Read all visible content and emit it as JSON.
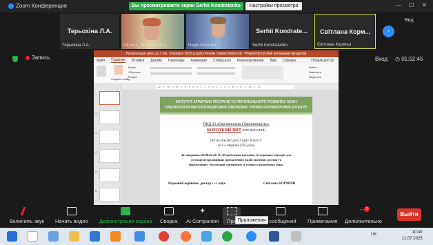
{
  "window": {
    "title": "Zoom Конференция",
    "share_banner": "Вы просматриваете экран Serhii Kondratenko",
    "view_settings": "Настройки просмотра",
    "view_label": "Вид",
    "controls": [
      "—",
      "☐",
      "✕"
    ]
  },
  "participants": [
    {
      "display": "Терьохіна Л.А.",
      "caption": "Терьохіна Л.А.",
      "video": false
    },
    {
      "display": "",
      "caption": "Oksana_SERHIIENKO",
      "video": true
    },
    {
      "display": "",
      "caption": "Надія Косенко",
      "video": true
    },
    {
      "display": "Serhii  Kondrate...",
      "caption": "Serhii Kondratenko",
      "video": false
    },
    {
      "display": "Світлана  Корм...",
      "caption": "Світлана Кормош",
      "video": false
    }
  ],
  "status": {
    "record_label": "Запись",
    "exit_label": "Вход",
    "timer": "01:52:45"
  },
  "ppt": {
    "title": "Презентація звіту за 1 пів. 20нравок 2025 р.pptx [Режим совместимости] - PowerPoint [Сбой активации продукта]",
    "tabs": [
      "Файл",
      "Главная",
      "Вставка",
      "Дизайн",
      "Переходы",
      "Анимация",
      "Слайд-шоу",
      "Рецензирование",
      "Вид",
      "Справка",
      "Общий доступ"
    ],
    "ribbon_labels": {
      "create": "Создать слайд",
      "layout": "Макет",
      "reset": "Сбросить",
      "section": "Раздел",
      "find": "Найти",
      "replace": "Заменить",
      "select": "Выделить"
    },
    "ruler": "· 12 · 1 · 10 · 1 · 8 · 1 · 6 · 1 · 4 · 1 · 2 · 1 · 0 · 1 · 2 · 1 · 4 · 1 · 6 · 1 · 8 · 1 · 10 · 1 · 12 ·",
    "thumb_numbers": [
      "1",
      "2",
      "3",
      "4",
      "5",
      "6"
    ]
  },
  "slide": {
    "institute_line1": "ІНСТИТУТ АГРАРНИХ РЕСУРСІВ ТА РЕГІОНАЛЬНОГО РОЗВИТКУ НААН",
    "institute_line2": "ЛАБОРАТОРІЯ МАЛООПОШИРЕНИХ ОВОЧЕВИХ І ПРЯНО-АРОМАТИЧНИХ КУЛЬТУР",
    "pnd": "ПНД 20 «Овочівництво і баштанництво»",
    "report_title": "КОРОТКИЙ ЗВІТ",
    "report_suffix": "(ПРЕЗЕНТАЦІЯ)",
    "about": "ПРО НАУКОВО-ДОСЛІДНУ РОБОТУ",
    "period": "за 1-е півріччя 2025 року",
    "task_line1": "За завданням 20.00.01.24. Ф «Розроблення наукових методичних підходів для",
    "task_line2": "селекції нетрадиційних ароматичних видів овочевих рослин та",
    "task_line3": "формування і збагачення сортименту в умовах кліматичних змін»",
    "supervisor": "Науковий керівник,  доктор с.-г. наук",
    "supervisor_name": "Світлана КОРМОШ"
  },
  "toolbar": {
    "mute": "Включить звук",
    "video": "Начать видео",
    "share": "Демонстрация экрана",
    "summary": "Сводка",
    "ai": "AI Companion",
    "apps": "При",
    "apps_tooltip": "Приложения",
    "chat": "и сообщений",
    "notes": "Примечания",
    "more": "Дополнительно",
    "more_badge": "1",
    "leave": "Выйти"
  },
  "taskbar": {
    "tray": "UK",
    "time": "10:40",
    "date": "11.07.2025"
  }
}
